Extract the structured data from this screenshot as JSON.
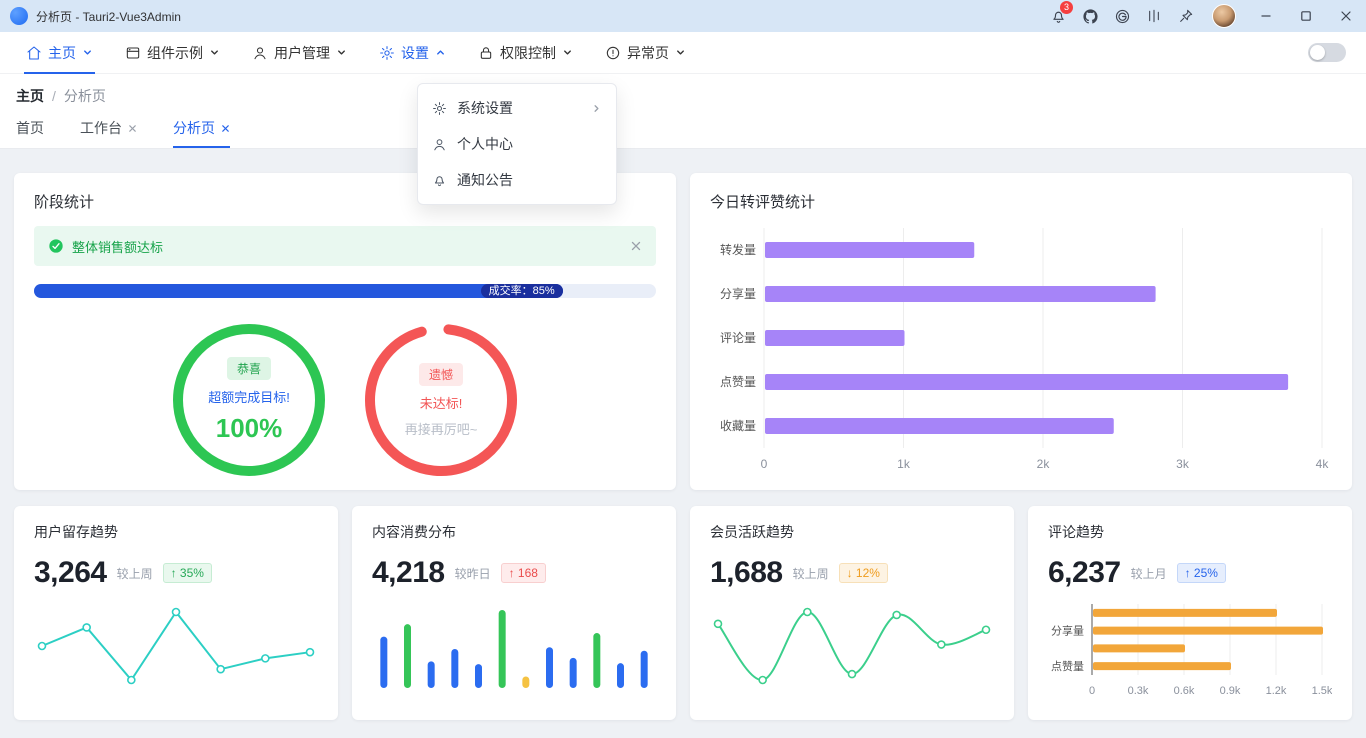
{
  "window": {
    "title": "分析页 - Tauri2-Vue3Admin",
    "notification_count": "3"
  },
  "navbar": {
    "items": [
      {
        "label": "主页"
      },
      {
        "label": "组件示例"
      },
      {
        "label": "用户管理"
      },
      {
        "label": "设置"
      },
      {
        "label": "权限控制"
      },
      {
        "label": "异常页"
      }
    ]
  },
  "settings_menu": {
    "items": [
      {
        "label": "系统设置"
      },
      {
        "label": "个人中心"
      },
      {
        "label": "通知公告"
      }
    ]
  },
  "breadcrumb": {
    "root": "主页",
    "separator": "/",
    "current": "分析页"
  },
  "tabs": [
    {
      "label": "首页"
    },
    {
      "label": "工作台"
    },
    {
      "label": "分析页"
    }
  ],
  "stage": {
    "title": "阶段统计",
    "alert_text": "整体销售额达标",
    "progress_label": "成交率：85%",
    "progress_percent": 85,
    "success_ring": {
      "badge": "恭喜",
      "message": "超额完成目标!",
      "value": "100%"
    },
    "fail_ring": {
      "badge": "遗憾",
      "message": "未达标!",
      "submessage": "再接再厉吧~"
    }
  },
  "stat_cards": [
    {
      "title": "用户留存趋势",
      "value": "3,264",
      "compare": "较上周",
      "badge": "↑ 35%"
    },
    {
      "title": "内容消费分布",
      "value": "4,218",
      "compare": "较昨日",
      "badge": "↑ 168"
    },
    {
      "title": "会员活跃趋势",
      "value": "1,688",
      "compare": "较上周",
      "badge": "↓ 12%"
    },
    {
      "title": "评论趋势",
      "value": "6,237",
      "compare": "较上月",
      "badge": "↑ 25%"
    }
  ],
  "colors": {
    "accent": "#2563eb",
    "success": "#2dc653",
    "danger": "#f25555",
    "warning": "#ef9c1e",
    "purple_bar": "#a684f8",
    "teal_line": "#2ccfc4",
    "green_line": "#3bcf8c",
    "orange_bar": "#f2a63a"
  },
  "chart_data": [
    {
      "id": "engagement",
      "type": "bar",
      "orientation": "horizontal",
      "title": "今日转评赞统计",
      "categories": [
        "转发量",
        "分享量",
        "评论量",
        "点赞量",
        "收藏量"
      ],
      "values": [
        1500,
        2800,
        1000,
        3750,
        2500
      ],
      "xlim": [
        0,
        4000
      ],
      "xticks": [
        "0",
        "1k",
        "2k",
        "3k",
        "4k"
      ],
      "bar_color": "#a684f8",
      "bar_thickness": 16,
      "label_width": 54,
      "tick_font": 12,
      "grid": true,
      "axis_line": false,
      "legend": "none"
    },
    {
      "id": "retention",
      "type": "line",
      "title": "用户留存趋势",
      "values": [
        40,
        52,
        18,
        62,
        25,
        32,
        36
      ],
      "color": "#2ccfc4",
      "smooth": false,
      "markers": true
    },
    {
      "id": "consumption",
      "type": "bar",
      "orientation": "vertical",
      "title": "内容消费分布",
      "values": [
        58,
        72,
        30,
        44,
        27,
        88,
        13,
        46,
        34,
        62,
        28,
        42
      ],
      "colors": [
        "#2b6cf0",
        "#35c558",
        "#2b6cf0",
        "#2b6cf0",
        "#2b6cf0",
        "#35c558",
        "#f5c242",
        "#2b6cf0",
        "#2b6cf0",
        "#35c558",
        "#2b6cf0",
        "#2b6cf0"
      ]
    },
    {
      "id": "member",
      "type": "line",
      "title": "会员活跃趋势",
      "values": [
        52,
        14,
        60,
        18,
        58,
        38,
        48
      ],
      "color": "#3bcf8c",
      "smooth": true,
      "markers": true
    },
    {
      "id": "comment",
      "type": "bar",
      "orientation": "horizontal",
      "title": "评论趋势",
      "categories": [
        "",
        "分享量",
        "",
        "点赞量"
      ],
      "values": [
        1200,
        1500,
        600,
        900
      ],
      "xlim": [
        0,
        1500
      ],
      "xticks": [
        "0",
        "0.3k",
        "0.6k",
        "0.9k",
        "1.2k",
        "1.5k"
      ],
      "bar_color": "#f2a63a",
      "bar_thickness": 8,
      "label_width": 44,
      "tick_font": 11,
      "grid": true,
      "axis_line": true
    }
  ]
}
